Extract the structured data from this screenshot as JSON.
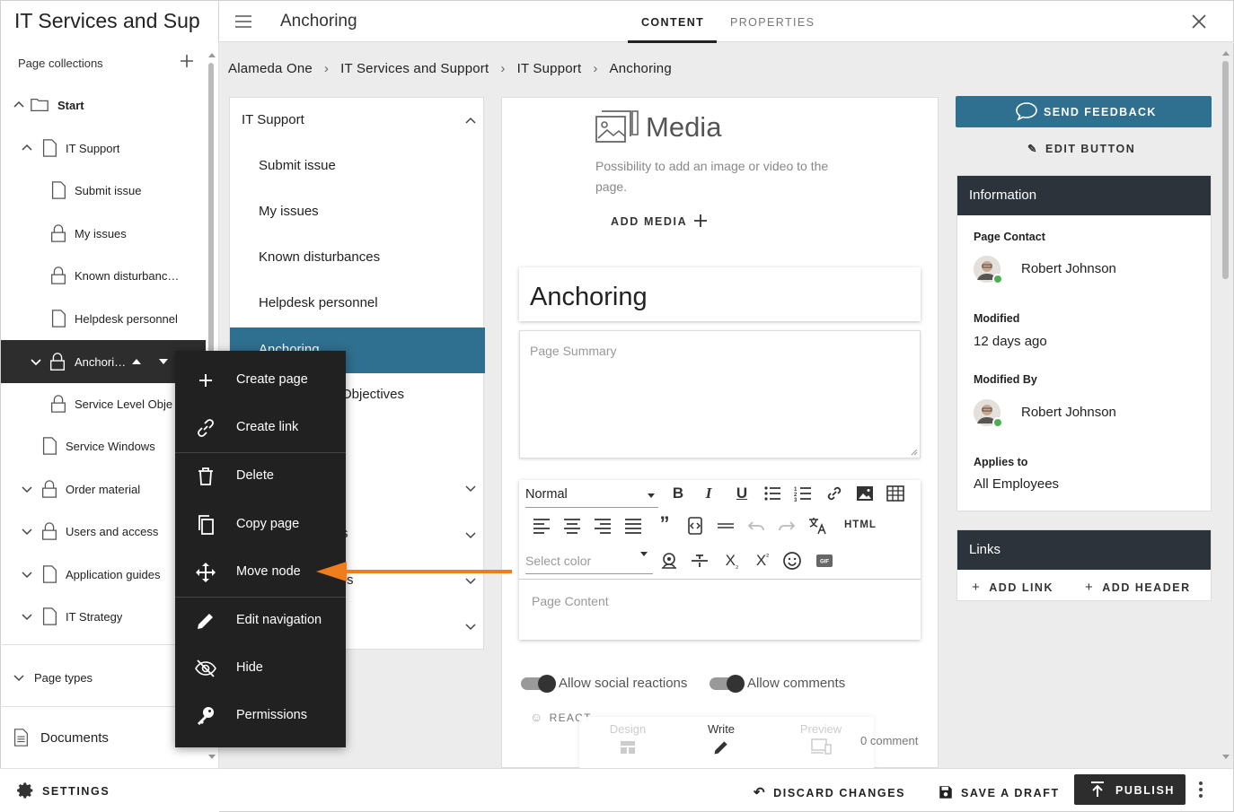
{
  "sidebar": {
    "site_title": "IT Services and Sup",
    "page_collections_label": "Page collections",
    "tree": {
      "start": "Start",
      "it_support": "IT Support",
      "submit_issue": "Submit issue",
      "my_issues": "My issues",
      "known_disturbances": "Known disturbanc…",
      "helpdesk_personnel": "Helpdesk personnel",
      "anchoring": "Anchori…",
      "service_level": "Service Level Obje",
      "service_windows": "Service Windows",
      "order_material": "Order material",
      "users_and_access": "Users and access",
      "application_guides": "Application guides",
      "it_strategy": "IT Strategy"
    },
    "page_types_label": "Page types",
    "documents_label": "Documents",
    "settings_label": "SETTINGS"
  },
  "topbar": {
    "page_name": "Anchoring",
    "tabs": [
      "CONTENT",
      "PROPERTIES"
    ],
    "active_tab": "CONTENT"
  },
  "breadcrumb": [
    "Alameda One",
    "IT Services and Support",
    "IT Support",
    "Anchoring"
  ],
  "nav_panel": {
    "header": "IT Support",
    "items": [
      "Submit issue",
      "My issues",
      "Known disturbances",
      "Helpdesk personnel",
      "Anchoring",
      "Objectives"
    ],
    "partial_s": "s",
    "partial_s2": "s"
  },
  "context_menu": {
    "items": [
      "Create page",
      "Create link",
      "Delete",
      "Copy page",
      "Move node",
      "Edit navigation",
      "Hide",
      "Permissions"
    ]
  },
  "content": {
    "media_title": "Media",
    "media_desc": "Possibility to add an image or video to the page.",
    "add_media": "ADD MEDIA",
    "page_title": "Anchoring",
    "summary_placeholder": "Page Summary",
    "format_value": "Normal",
    "color_placeholder": "Select color",
    "html_label": "HTML",
    "content_placeholder": "Page Content",
    "allow_social": "Allow social reactions",
    "allow_comments": "Allow comments",
    "react_label": "REACT",
    "modes": [
      "Design",
      "Write",
      "Preview"
    ],
    "active_mode": "Write",
    "comment_label": "0 comment"
  },
  "right": {
    "send_feedback": "SEND FEEDBACK",
    "edit_button": "EDIT BUTTON",
    "info_title": "Information",
    "page_contact_label": "Page Contact",
    "page_contact": "Robert Johnson",
    "modified_label": "Modified",
    "modified": "12 days ago",
    "modified_by_label": "Modified By",
    "modified_by": "Robert Johnson",
    "applies_to_label": "Applies to",
    "applies_to": "All Employees",
    "links_title": "Links",
    "add_link": "ADD LINK",
    "add_header": "ADD HEADER"
  },
  "actions": {
    "discard": "DISCARD CHANGES",
    "save_draft": "SAVE A DRAFT",
    "publish": "PUBLISH"
  },
  "colors": {
    "accent": "#2f6f8f",
    "dark": "#212121",
    "arrow": "#f07d1d",
    "status_online": "#4caf50"
  }
}
